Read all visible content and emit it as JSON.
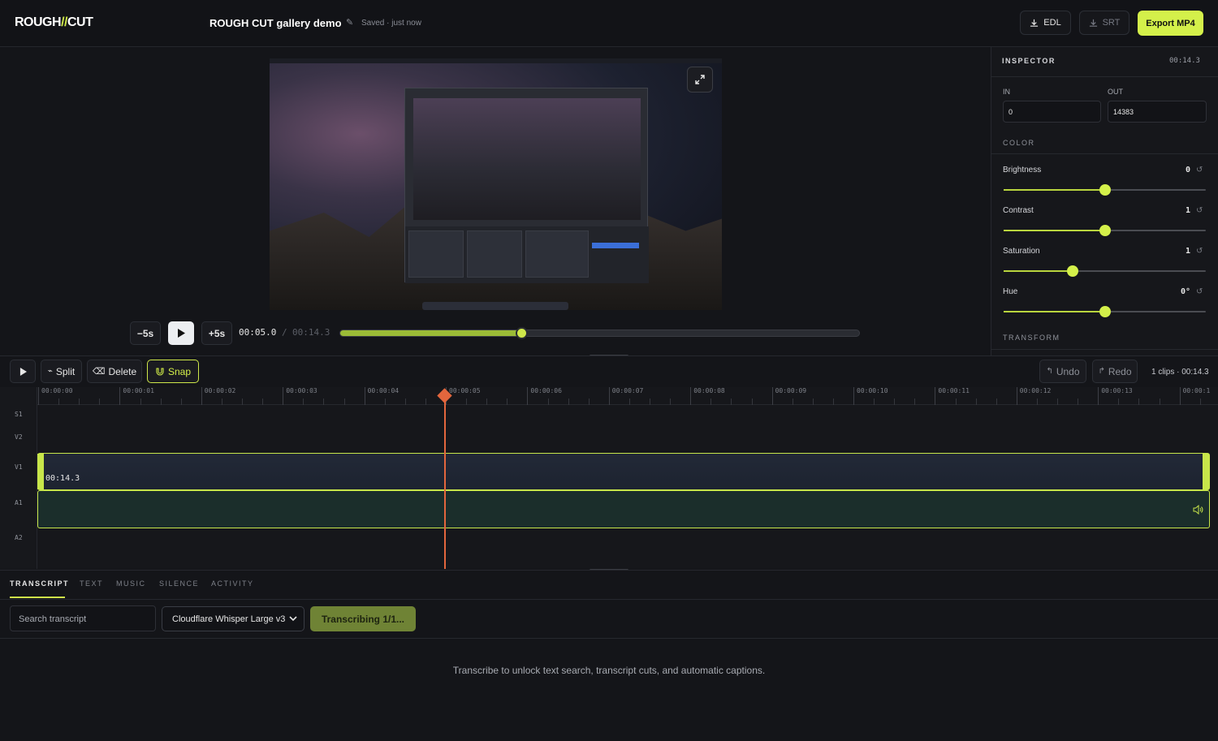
{
  "header": {
    "logo_left": "ROUGH",
    "logo_sep": "//",
    "logo_right": "CUT",
    "project_title": "ROUGH CUT gallery demo",
    "save_status": "Saved · just now",
    "edl_label": "EDL",
    "srt_label": "SRT",
    "export_label": "Export MP4"
  },
  "transport": {
    "back_label": "−5s",
    "fwd_label": "+5s",
    "current_time": "00:05.0",
    "separator": "/",
    "total_time": "00:14.3",
    "progress": 0.35
  },
  "inspector": {
    "title": "INSPECTOR",
    "time": "00:14.3",
    "in_label": "IN",
    "in_value": "0",
    "out_label": "OUT",
    "out_value": "14383",
    "color_section": "COLOR",
    "transform_section": "TRANSFORM",
    "sliders": [
      {
        "label": "Brightness",
        "value": "0",
        "fraction": 0.5
      },
      {
        "label": "Contrast",
        "value": "1",
        "fraction": 0.5
      },
      {
        "label": "Saturation",
        "value": "1",
        "fraction": 0.34
      },
      {
        "label": "Hue",
        "value": "0°",
        "fraction": 0.5
      }
    ]
  },
  "timeline": {
    "split_label": "Split",
    "delete_label": "Delete",
    "snap_label": "Snap",
    "undo_label": "Undo",
    "redo_label": "Redo",
    "clip_info": "1 clips · 00:14.3",
    "ruler_labels": [
      "00:00:00",
      "00:00:01",
      "00:00:02",
      "00:00:03",
      "00:00:04",
      "00:00:05",
      "00:00:06",
      "00:00:07",
      "00:00:08",
      "00:00:09",
      "00:00:10",
      "00:00:11",
      "00:00:12",
      "00:00:13",
      "00:00:1"
    ],
    "tracks": [
      "S1",
      "V2",
      "V1",
      "A1",
      "A2"
    ],
    "clip_label": "00:14.3"
  },
  "bottom": {
    "tabs": [
      "TRANSCRIPT",
      "TEXT",
      "MUSIC",
      "SILENCE",
      "ACTIVITY"
    ],
    "search_placeholder": "Search transcript",
    "model_selected": "Cloudflare Whisper Large v3",
    "transcribe_label": "Transcribing 1/1...",
    "empty_message": "Transcribe to unlock text search, transcript cuts, and automatic captions."
  },
  "colors": {
    "accent": "#d4f04a",
    "playhead": "#e3663d"
  }
}
